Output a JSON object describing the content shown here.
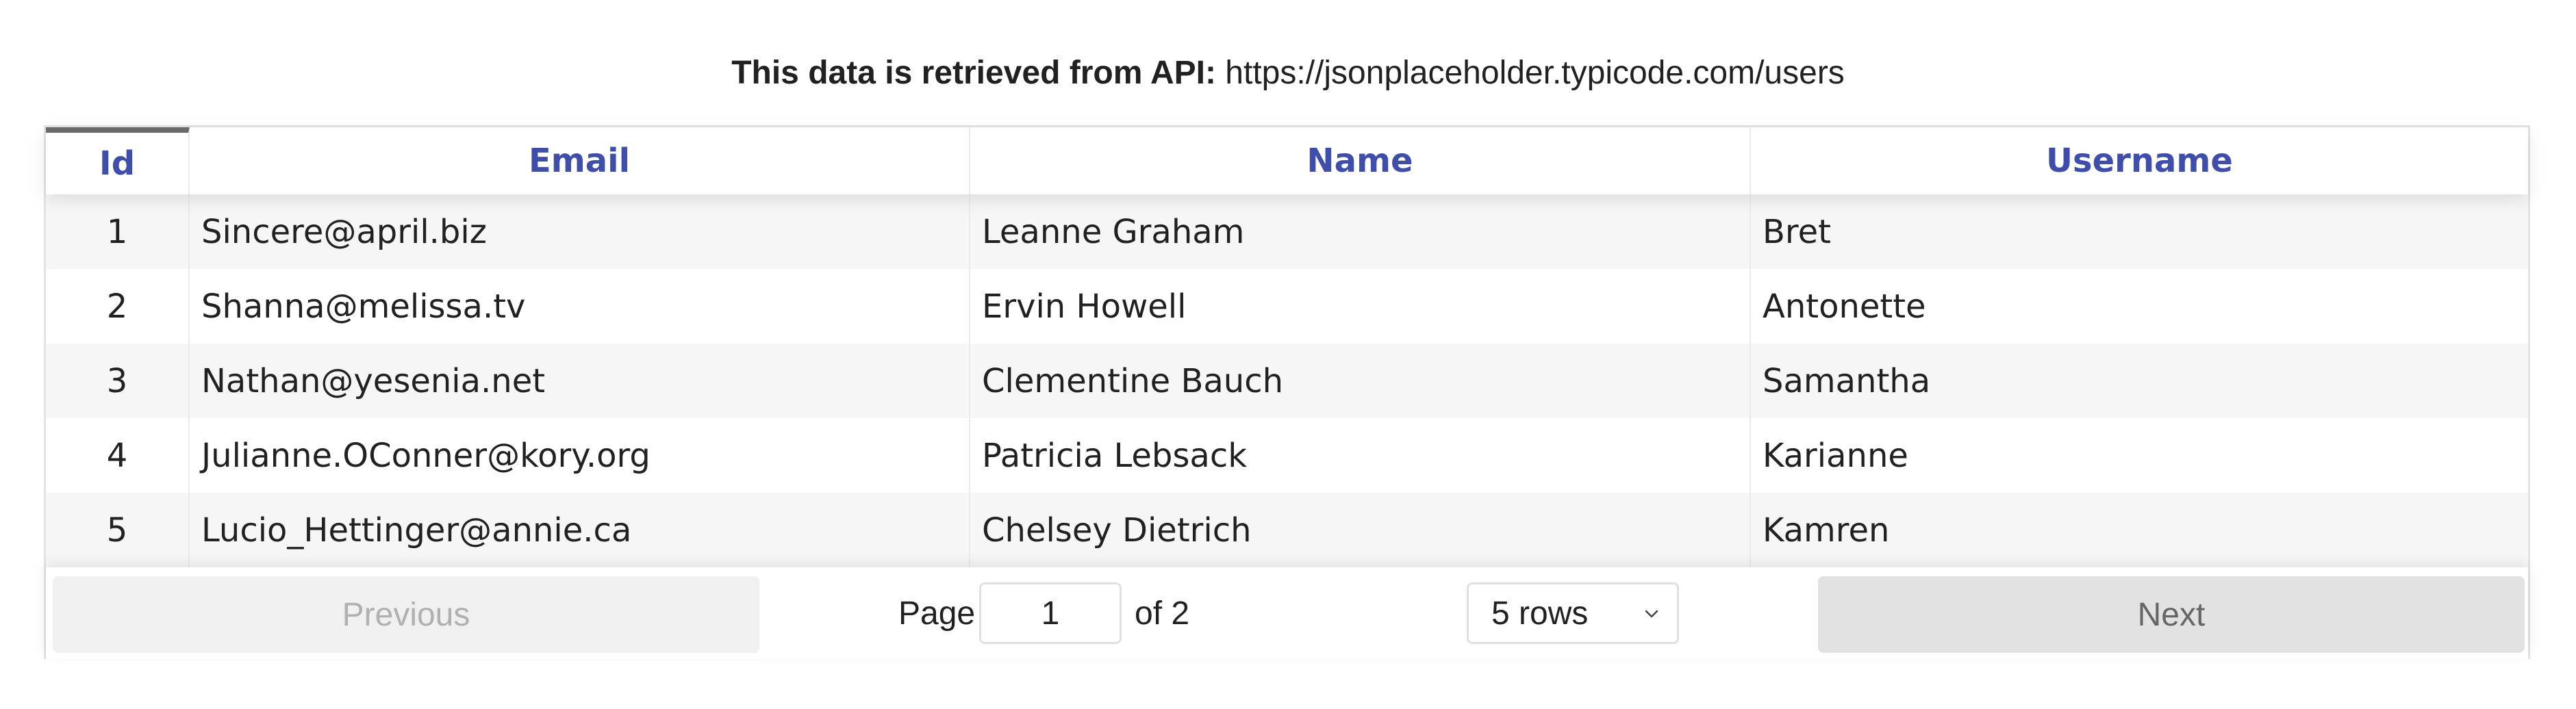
{
  "caption": {
    "label": "This data is retrieved from API:",
    "url": "https://jsonplaceholder.typicode.com/users"
  },
  "table": {
    "headers": [
      "Id",
      "Email",
      "Name",
      "Username"
    ],
    "sorted_column": "Id",
    "rows": [
      {
        "id": "1",
        "email": "Sincere@april.biz",
        "name": "Leanne Graham",
        "username": "Bret"
      },
      {
        "id": "2",
        "email": "Shanna@melissa.tv",
        "name": "Ervin Howell",
        "username": "Antonette"
      },
      {
        "id": "3",
        "email": "Nathan@yesenia.net",
        "name": "Clementine Bauch",
        "username": "Samantha"
      },
      {
        "id": "4",
        "email": "Julianne.OConner@kory.org",
        "name": "Patricia Lebsack",
        "username": "Karianne"
      },
      {
        "id": "5",
        "email": "Lucio_Hettinger@annie.ca",
        "name": "Chelsey Dietrich",
        "username": "Kamren"
      }
    ]
  },
  "pagination": {
    "previous_label": "Previous",
    "page_label": "Page",
    "current_page": "1",
    "of_label": "of 2",
    "rows_per_page": "5 rows",
    "next_label": "Next",
    "chevron_icon": "chevron-down-icon"
  }
}
